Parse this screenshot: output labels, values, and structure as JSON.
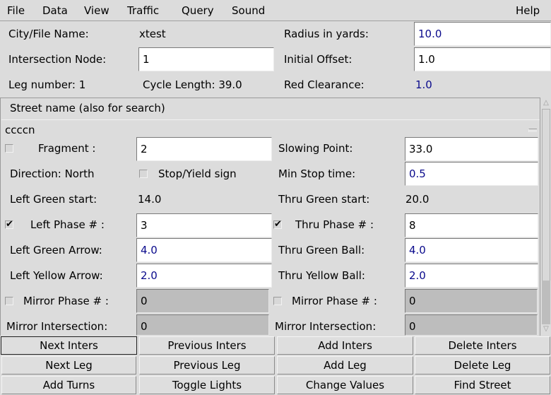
{
  "menubar": {
    "items": [
      "File",
      "Data",
      "View",
      "Traffic",
      "Query",
      "Sound"
    ],
    "help": "Help"
  },
  "header": {
    "city_file_label": "City/File Name:",
    "city_file_value": "xtest",
    "intersection_label": "Intersection Node:",
    "intersection_value": "1",
    "leg_number": "Leg number: 1",
    "cycle_length": "Cycle Length: 39.0",
    "radius_label": "Radius in yards:",
    "radius_value": "10.0",
    "offset_label": "Initial Offset:",
    "offset_value": "1.0",
    "red_clearance_label": "Red Clearance:",
    "red_clearance_value": "1.0"
  },
  "leg_panel": {
    "street_header": "Street name (also for search)",
    "street_value": "ccccn",
    "fragment": {
      "label": "Fragment :",
      "value": "2",
      "checked": false
    },
    "slowing_point": {
      "label": "Slowing Point:",
      "value": "33.0"
    },
    "direction": "Direction: North",
    "stop_yield": {
      "label": "Stop/Yield sign",
      "checked": false
    },
    "min_stop": {
      "label": "Min Stop time:",
      "value": "0.5"
    },
    "left_green_start": {
      "label": "Left Green start:",
      "value": "14.0"
    },
    "thru_green_start": {
      "label": "Thru Green start:",
      "value": "20.0"
    },
    "left_phase": {
      "label": "Left Phase # :",
      "value": "3",
      "checked": true
    },
    "thru_phase": {
      "label": "Thru Phase # :",
      "value": "8",
      "checked": true
    },
    "left_green_arrow": {
      "label": "Left Green Arrow:",
      "value": "4.0"
    },
    "thru_green_ball": {
      "label": "Thru Green Ball:",
      "value": "4.0"
    },
    "left_yellow_arrow": {
      "label": "Left Yellow Arrow:",
      "value": "2.0"
    },
    "thru_yellow_ball": {
      "label": "Thru Yellow Ball:",
      "value": "2.0"
    },
    "left_mirror_phase": {
      "label": "Mirror Phase # :",
      "value": "0",
      "checked": false
    },
    "right_mirror_phase": {
      "label": "Mirror Phase # :",
      "value": "0",
      "checked": false
    },
    "left_mirror_inters": {
      "label": "Mirror Intersection:",
      "value": "0"
    },
    "right_mirror_inters": {
      "label": "Mirror Intersection:",
      "value": "0"
    },
    "check_mark": "✔"
  },
  "scrollbar": {
    "up": "△",
    "down": "▽",
    "position": 0.85
  },
  "buttons": {
    "row1": [
      "Next Inters",
      "Previous Inters",
      "Add Inters",
      "Delete Inters"
    ],
    "row2": [
      "Next Leg",
      "Previous Leg",
      "Add Leg",
      "Delete Leg"
    ],
    "row3": [
      "Add Turns",
      "Toggle Lights",
      "Change Values",
      "Find Street"
    ]
  }
}
